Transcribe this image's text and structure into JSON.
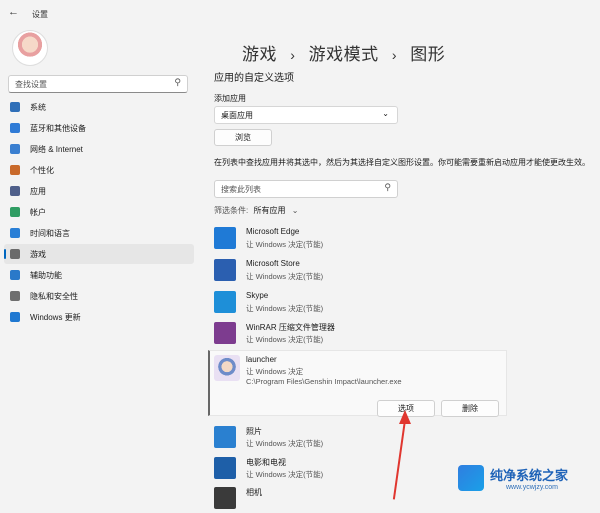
{
  "window": {
    "title": "设置"
  },
  "sidebar": {
    "search_placeholder": "查找设置",
    "items": [
      {
        "label": "系统",
        "color": "#2f6fb8"
      },
      {
        "label": "蓝牙和其他设备",
        "color": "#2f7bd6"
      },
      {
        "label": "网络 & Internet",
        "color": "#3a7fd0"
      },
      {
        "label": "个性化",
        "color": "#c96a2b"
      },
      {
        "label": "应用",
        "color": "#4f5f8a"
      },
      {
        "label": "帐户",
        "color": "#2f9d63"
      },
      {
        "label": "时间和语言",
        "color": "#2a7fd6"
      },
      {
        "label": "游戏",
        "color": "#6b6b6b",
        "active": true
      },
      {
        "label": "辅助功能",
        "color": "#2a79c9"
      },
      {
        "label": "隐私和安全性",
        "color": "#6e6e6e"
      },
      {
        "label": "Windows 更新",
        "color": "#1f78d1"
      }
    ]
  },
  "breadcrumb": {
    "p1": "游戏",
    "p2": "游戏模式",
    "p3": "图形",
    "sep": "›"
  },
  "main": {
    "section_title": "应用的自定义选项",
    "add_app_label": "添加应用",
    "app_type_value": "桌面应用",
    "browse_label": "浏览",
    "description": "在列表中查找应用并将其选中，然后为其选择自定义图形设置。你可能需要重新启动应用才能使更改生效。",
    "list_search_placeholder": "搜索此列表",
    "filter_label": "筛选条件:",
    "filter_value": "所有应用"
  },
  "apps": [
    {
      "name": "Microsoft Edge",
      "sub": "让 Windows 决定(节能)",
      "color": "#1f7ad6"
    },
    {
      "name": "Microsoft Store",
      "sub": "让 Windows 决定(节能)",
      "color": "#2b5fb0"
    },
    {
      "name": "Skype",
      "sub": "让 Windows 决定(节能)",
      "color": "#1e8fd8"
    },
    {
      "name": "WinRAR 压缩文件管理器",
      "sub": "让 Windows 决定(节能)",
      "color": "#7d3c8f"
    }
  ],
  "expanded_app": {
    "name": "launcher",
    "sub": "让 Windows 决定",
    "path": "C:\\Program Files\\Genshin Impact\\launcher.exe",
    "options_label": "选项",
    "delete_label": "删除"
  },
  "apps_after": [
    {
      "name": "照片",
      "sub": "让 Windows 决定(节能)",
      "color": "#2a80d0"
    },
    {
      "name": "电影和电视",
      "sub": "让 Windows 决定(节能)",
      "color": "#1e5fa8"
    },
    {
      "name": "相机",
      "sub": "",
      "color": "#3a3a3a"
    }
  ],
  "watermark": {
    "title": "纯净系统之家",
    "url": "www.ycwjzy.com"
  },
  "colors": {
    "accent": "#0067c0",
    "arrow": "#e0362f"
  }
}
